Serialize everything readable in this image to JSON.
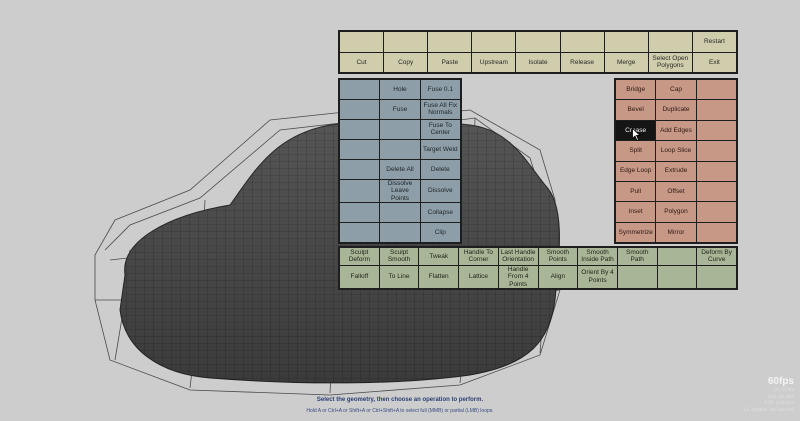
{
  "top_panel": {
    "row1": [
      "",
      "",
      "",
      "",
      "",
      "",
      "",
      "",
      "Restart"
    ],
    "row2": [
      "Cut",
      "Copy",
      "Paste",
      "Upstream",
      "Isolate",
      "Release",
      "Merge",
      "Select Open Polygons",
      "Exit"
    ]
  },
  "left_panel": {
    "rows": [
      [
        "",
        "Hole",
        "Fuse 0.1"
      ],
      [
        "",
        "Fuse",
        "Fuse All Fix Normals"
      ],
      [
        "",
        "",
        "Fuse To Center"
      ],
      [
        "",
        "",
        "Target Weld"
      ],
      [
        "",
        "Delete All",
        "Delete"
      ],
      [
        "",
        "Dissolve Leave Points",
        "Dissolve"
      ],
      [
        "",
        "",
        "Collapse"
      ],
      [
        "",
        "",
        "Clip"
      ]
    ]
  },
  "right_panel": {
    "rows": [
      [
        "Bridge",
        "Cap",
        ""
      ],
      [
        "Bevel",
        "Duplicate",
        ""
      ],
      [
        "Crease",
        "Add Edges",
        ""
      ],
      [
        "Split",
        "Loop Slice",
        ""
      ],
      [
        "Edge Loop",
        "Extrude",
        ""
      ],
      [
        "Pull",
        "Offset",
        ""
      ],
      [
        "Inset",
        "Polygon",
        ""
      ],
      [
        "Symmetrize",
        "Mirror",
        ""
      ]
    ],
    "selected": "Crease"
  },
  "bottom_panel": {
    "row1": [
      "Sculpt Deform",
      "Sculpt Smooth",
      "Tweak",
      "Handle To Corner",
      "Last Handle Orientation",
      "Smooth Points",
      "Smooth Inside Path",
      "Smooth Path",
      "",
      "Deform By Curve"
    ],
    "row2": [
      "Falloff",
      "To Line",
      "Flatten",
      "Lattice",
      "Handle From 4 Points",
      "Align",
      "Orient By 4 Points",
      "",
      "",
      ""
    ]
  },
  "status": {
    "instruction": "Select the geometry, then choose an operation to perform.",
    "hint": "Hold A or Ctrl+A or Shift+A or Ctrl+Shift+A to select full (MMB) or partial (LMB) loops."
  },
  "hud": {
    "fps": "60fps",
    "frame_ms": "16.67ms",
    "prims": "120  prims",
    "points": "128 points",
    "edges": "12 edges selected"
  },
  "colors": {
    "background": "#cdcdcd",
    "mesh_fill": "#5b5b5b",
    "top_panel": "#cfcdab",
    "left_panel": "#8e9ea8",
    "right_panel": "#c89886",
    "bottom_panel": "#a8b596",
    "selected": "#151515"
  },
  "icons": [
    "mouse-cursor-icon"
  ]
}
